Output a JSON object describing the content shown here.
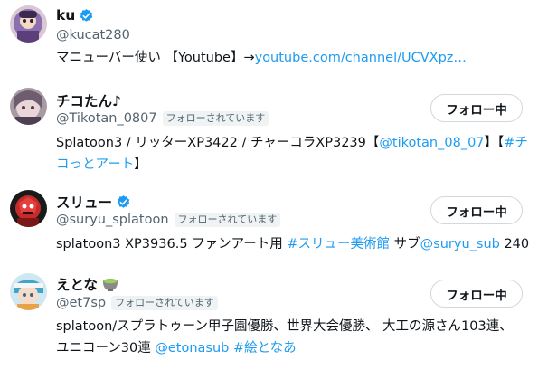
{
  "users": [
    {
      "name": "ku",
      "verified": true,
      "handle": "@kucat280",
      "follows_you": "",
      "bio_text": "マニューバー使い 【Youtube】→",
      "bio_link": "youtube.com/channel/UCVXpz…",
      "button": ""
    },
    {
      "name": "チコたん♪",
      "verified": false,
      "handle": "@Tikotan_0807",
      "follows_you": "フォローされています",
      "bio_line1_a": "Splatoon3 / リッターXP3422 / チャーコラXP3239【",
      "bio_line1_link1": "@tikotan_08_07",
      "bio_line1_b": "】【",
      "bio_line1_link2": "#チ",
      "bio_line2_link": "コっとアート",
      "bio_line2_b": "】",
      "button": "フォロー中"
    },
    {
      "name": "スリュー",
      "verified": true,
      "handle": "@suryu_splatoon",
      "follows_you": "フォローされています",
      "bio_a": "splatoon3 XP3936.5 ファンアート用 ",
      "bio_link1": "#スリュー美術館",
      "bio_b": " サブ",
      "bio_link2": "@suryu_sub",
      "bio_c": " 240",
      "button": "フォロー中"
    },
    {
      "name": "えとな",
      "verified": false,
      "name_emoji": "tea-bowl-emoji",
      "handle": "@et7sp",
      "follows_you": "フォローされています",
      "bio_line1": "splatoon/スプラトゥーン甲子園優勝、世界大会優勝、 大工の源さん103連、",
      "bio_line2_a": "ユニコーン30連 ",
      "bio_line2_link1": "@etonasub",
      "bio_line2_sep": " ",
      "bio_line2_link2": "#絵となあ",
      "button": "フォロー中"
    }
  ],
  "colors": {
    "accent": "#1d9bf0",
    "text": "#0f1419",
    "muted": "#536471",
    "badge_bg": "#eff3f4",
    "button_border": "#cfd9de"
  }
}
